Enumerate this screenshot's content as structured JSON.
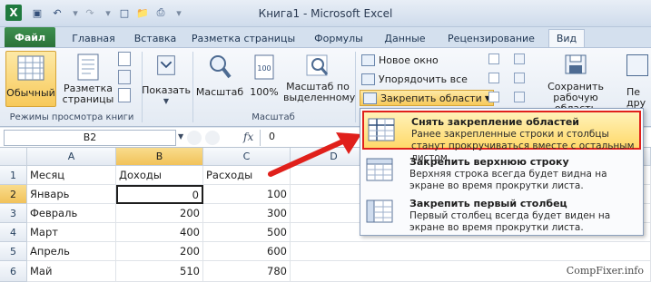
{
  "window": {
    "title": "Книга1 - Microsoft Excel"
  },
  "tabs": [
    "Файл",
    "Главная",
    "Вставка",
    "Разметка страницы",
    "Формулы",
    "Данные",
    "Рецензирование",
    "Вид"
  ],
  "ribbon": {
    "group_views": {
      "label": "Режимы просмотра книги",
      "normal": "Обычный",
      "page_layout": "Разметка страницы",
      "show": "Показать"
    },
    "group_zoom": {
      "label": "Масштаб",
      "zoom": "Масштаб",
      "zoom100": "100%",
      "zoom_selection": "Масштаб по выделенному"
    },
    "group_window": {
      "new_window": "Новое окно",
      "arrange_all": "Упорядочить все",
      "freeze_panes": "Закрепить области",
      "save_workspace": "Сохранить рабочую область",
      "next_cut": "Пе",
      "next_cut2": "дру"
    }
  },
  "formula_bar": {
    "name_box": "B2",
    "fx_label": "fx",
    "value": "0"
  },
  "grid": {
    "columns": [
      "A",
      "B",
      "C",
      "D"
    ],
    "rows": [
      {
        "num": "1",
        "a": "Месяц",
        "b": "Доходы",
        "c": "Расходы"
      },
      {
        "num": "2",
        "a": "Январь",
        "b": "0",
        "c": "100"
      },
      {
        "num": "3",
        "a": "Февраль",
        "b": "200",
        "c": "300"
      },
      {
        "num": "4",
        "a": "Март",
        "b": "400",
        "c": "500"
      },
      {
        "num": "5",
        "a": "Апрель",
        "b": "200",
        "c": "600"
      },
      {
        "num": "6",
        "a": "Май",
        "b": "510",
        "c": "780"
      }
    ]
  },
  "freeze_menu": {
    "items": [
      {
        "title": "Снять закрепление областей",
        "desc": "Ранее закрепленные строки и столбцы станут прокручиваться вместе с остальным листом."
      },
      {
        "title": "Закрепить верхнюю строку",
        "desc": "Верхняя строка всегда будет видна на экране во время прокрутки листа."
      },
      {
        "title": "Закрепить первый столбец",
        "desc": "Первый столбец всегда будет виден на экране во время прокрутки листа."
      }
    ]
  },
  "watermark": "CompFixer.info",
  "colors": {
    "highlight_red": "#e0201b",
    "file_tab": "#2b7239",
    "selection": "#f1c25a"
  }
}
